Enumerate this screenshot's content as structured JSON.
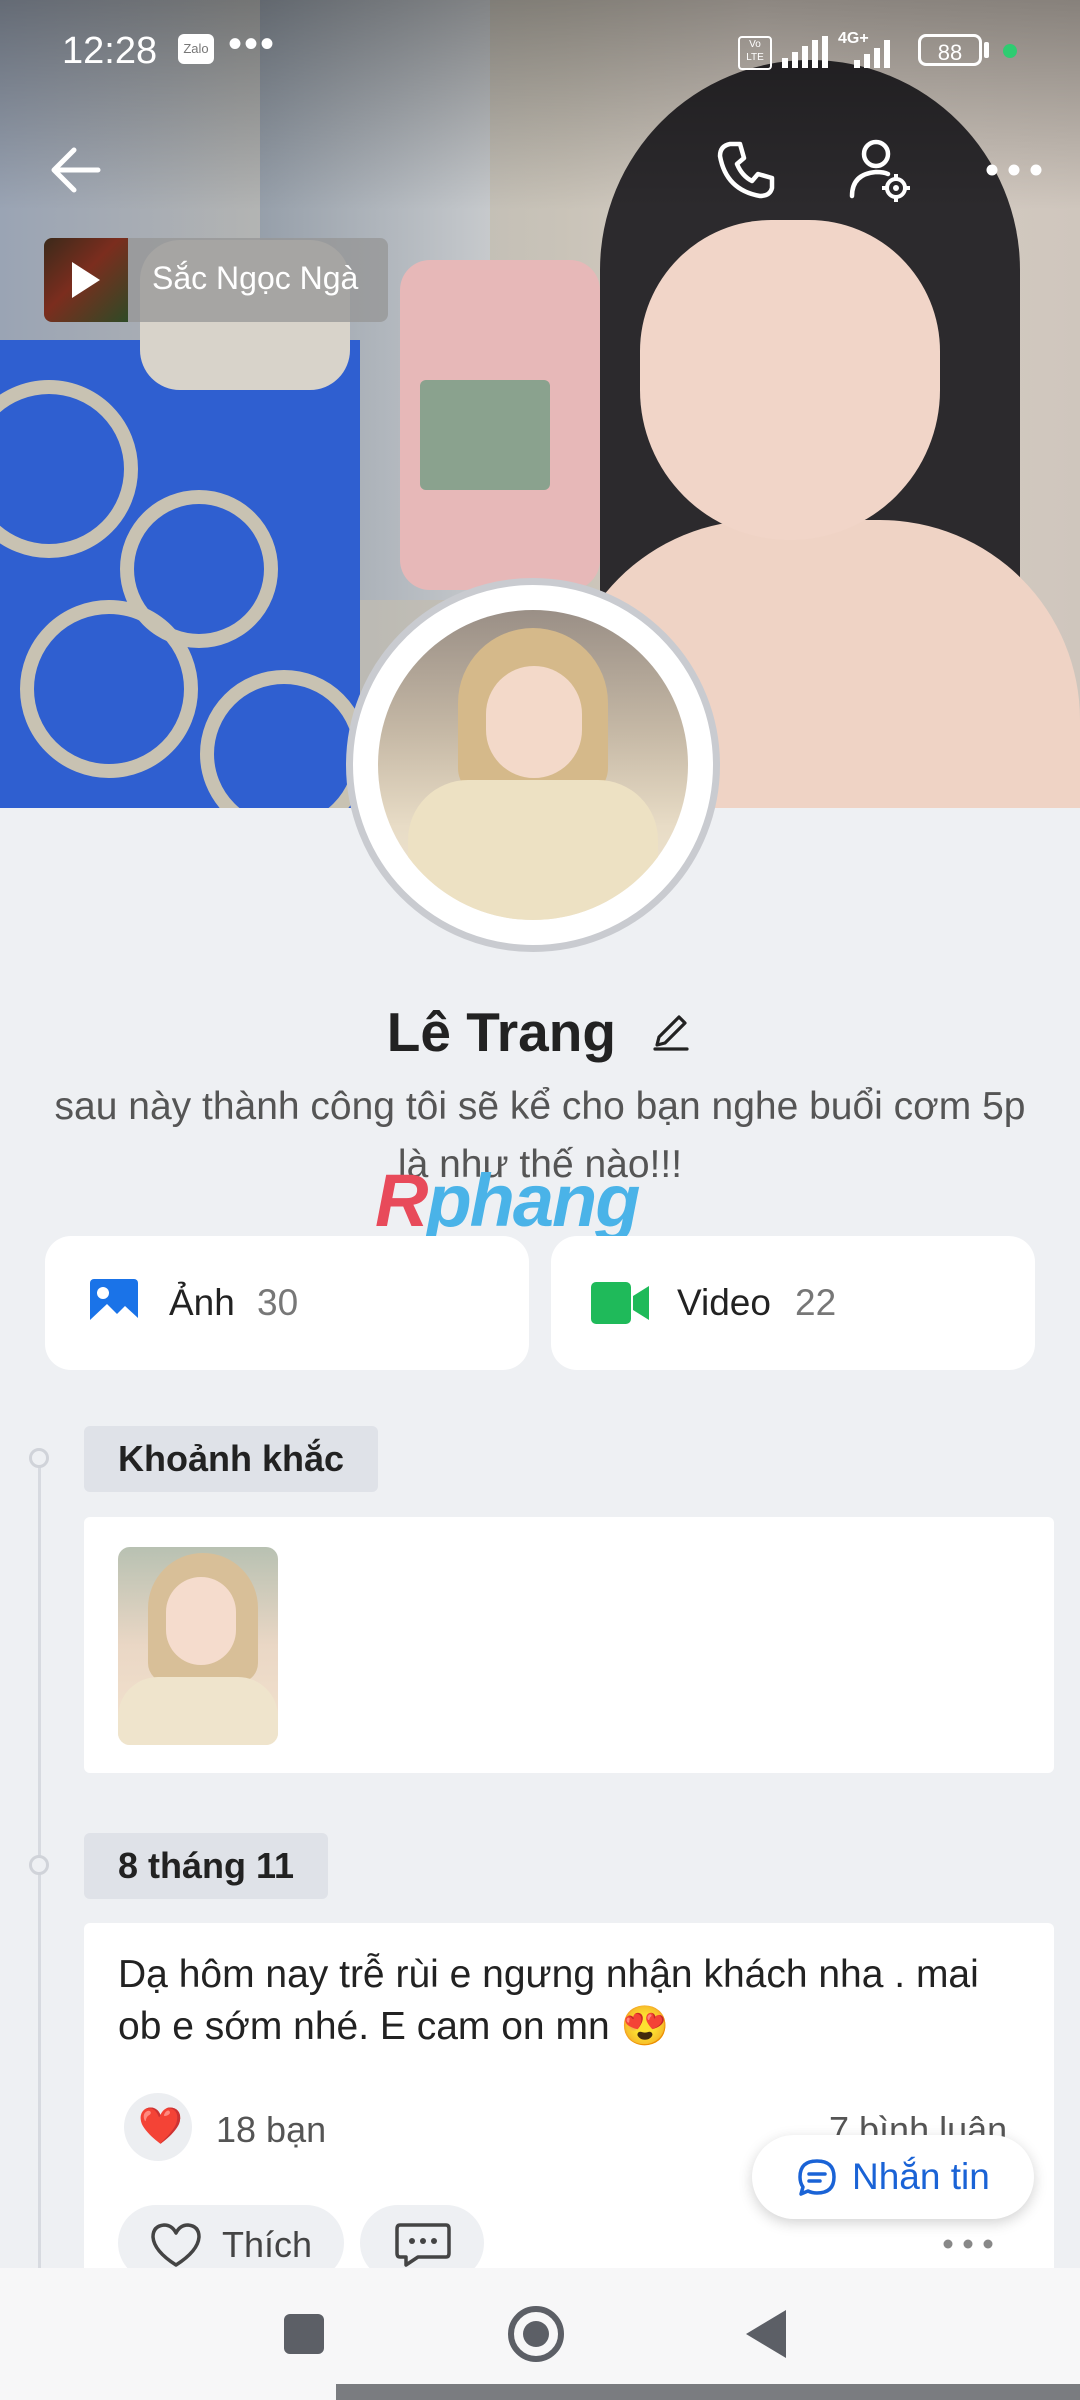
{
  "status_bar": {
    "time": "12:28",
    "app_icon": "Zalo",
    "more": "•••",
    "volte": "Vo LTE",
    "network": "4G+",
    "battery": "88"
  },
  "header": {
    "back_icon": "arrow-left-icon",
    "call_icon": "phone-icon",
    "settings_icon": "user-gear-icon",
    "more_icon": "more-horizontal-icon"
  },
  "music": {
    "title": "Sắc Ngọc Ngà"
  },
  "profile": {
    "name": "Lê Trang",
    "bio": "sau này thành công tôi sẽ kể cho bạn nghe buổi cơm 5p là như thế nào!!!"
  },
  "watermark": {
    "part1": "R",
    "part2": "phang"
  },
  "media": [
    {
      "label": "Ảnh",
      "count": "30",
      "icon": "image-icon",
      "color": "#1a73e8"
    },
    {
      "label": "Video",
      "count": "22",
      "icon": "video-icon",
      "color": "#1fba5a"
    }
  ],
  "timeline": {
    "moments_tag": "Khoảnh khắc",
    "date_tag": "8 tháng 11",
    "post": {
      "text": "Dạ hôm nay trễ rùi e ngưng nhận khách nha . mai ob e sớm nhé. E cam on mn 😍",
      "reaction_emoji": "❤️",
      "likes": "18 bạn",
      "comments": "7 bình luận",
      "like_button": "Thích"
    }
  },
  "floating": {
    "message_button": "Nhắn tin"
  },
  "colors": {
    "accent": "#1a63d6",
    "background": "#eef0f3",
    "photo_icon": "#1a73e8",
    "video_icon": "#1fba5a"
  }
}
